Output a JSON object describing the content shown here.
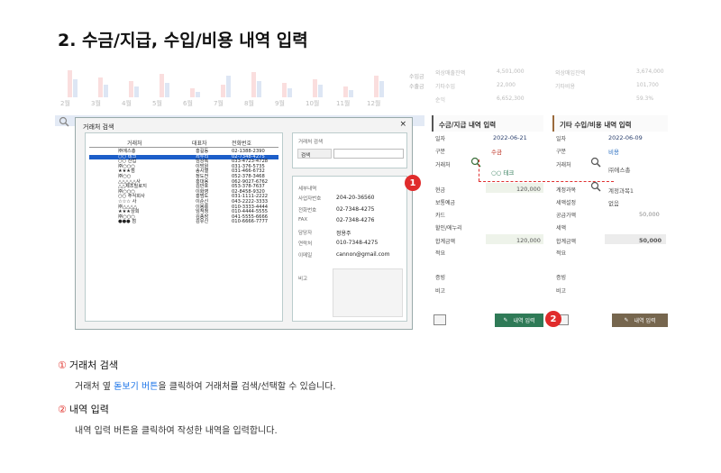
{
  "page_title": "2. 수금/지급, 수입/비용 내역 입력",
  "months": [
    "2월",
    "3월",
    "4월",
    "5월",
    "6월",
    "7월",
    "8월",
    "9월",
    "10월",
    "11월",
    "12월"
  ],
  "legend": [
    "수입금",
    "수출금"
  ],
  "summary": {
    "rows": [
      {
        "label": "외상매출잔액",
        "value": "4,501,000",
        "label2": "외상매입잔액",
        "value2": "3,674,000"
      },
      {
        "label": "기타수입",
        "value": "22,000",
        "label2": "기타비용",
        "value2": "101,700"
      },
      {
        "label": "순익",
        "value": "6,652,300",
        "label2": "",
        "value2": "59.3%"
      }
    ]
  },
  "dialog": {
    "title": "거래처 검색",
    "close": "×",
    "columns": [
      "거래처",
      "대표자",
      "전화번호"
    ],
    "rows": [
      [
        "㈜에스총",
        "홍길동",
        "02-1388-2390"
      ],
      [
        "○○ 테크",
        "최두리",
        "02-7348-4275"
      ],
      [
        "○○ 산업",
        "임상복",
        "033-4723-4728"
      ],
      [
        "㈜○○○",
        "이방원",
        "031-376-5735"
      ],
      [
        "★★★점",
        "송시열",
        "031-466-6732"
      ],
      [
        "㈜○○",
        "정도전",
        "052-378-3468"
      ],
      [
        "△△△△△사",
        "홍대용",
        "062-9027-6762"
      ],
      [
        "△△제조빌로지",
        "김만호",
        "053-378-7637"
      ],
      [
        "㈜○○○",
        "이화영",
        "02-8458-9320"
      ],
      [
        "○○ 주식회사",
        "홍범도",
        "031-1111-2222"
      ],
      [
        "☆☆☆ 사",
        "이순신",
        "043-2222-3333"
      ],
      [
        "㈜△△△△",
        "이봉룡",
        "010-3333-4444"
      ],
      [
        "★★★상회",
        "임적정",
        "010-4444-5555"
      ],
      [
        "㈜○○○",
        "김종장",
        "041-5555-6666"
      ],
      [
        "●●● 점",
        "김유신",
        "010-6666-7777"
      ]
    ],
    "search_panel_title": "거래처 검색",
    "search_label": "검색",
    "detail_panel_title": "세부내역",
    "details": [
      {
        "label": "사업자번호",
        "value": "204-20-36560"
      },
      {
        "label": "전화번호",
        "value": "02-7348-4275"
      },
      {
        "label": "FAX",
        "value": "02-7348-4276"
      },
      {
        "label": "담당자",
        "value": "정용주"
      },
      {
        "label": "연락처",
        "value": "010-7348-4275"
      },
      {
        "label": "이메일",
        "value": "cannon@gmail.com"
      },
      {
        "label": "비고",
        "value": ""
      }
    ]
  },
  "form_left": {
    "title": "수금/지급 내역 입력",
    "date_label": "일자",
    "date": "2022-06-21",
    "type_label": "구분",
    "type": "수금",
    "client_label": "거래처",
    "client": "○○ 테크",
    "cash_label": "현금",
    "cash": "120,000",
    "deposit_label": "보통예금",
    "card_label": "카드",
    "discount_label": "할인/에누리",
    "total_label": "합계금액",
    "total": "120,000",
    "memo_label": "적요",
    "proof_label": "증빙",
    "note_label": "비고",
    "submit": "내역 입력"
  },
  "form_right": {
    "title": "기타 수입/비용 내역 입력",
    "date_label": "일자",
    "date": "2022-06-09",
    "type_label": "구분",
    "type": "비용",
    "client_label": "거래처",
    "client": "㈜에스총",
    "account_label": "계정과목",
    "account": "계정과목1",
    "tax_label": "세액설정",
    "tax": "없음",
    "supply_label": "공급가액",
    "supply": "50,000",
    "vat_label": "세액",
    "total_label": "합계금액",
    "total": "50,000",
    "memo_label": "적요",
    "proof_label": "증빙",
    "note_label": "비고",
    "submit": "내역 입력"
  },
  "markers": [
    "1",
    "2"
  ],
  "sections": [
    {
      "num": "①",
      "title": "거래처 검색",
      "desc_pre": "거래처 옆 ",
      "desc_link": "돋보기 버튼",
      "desc_post": "을 클릭하여 거래처를 검색/선택할 수 있습니다."
    },
    {
      "num": "②",
      "title": "내역 입력",
      "desc_pre": "내역 입력 버튼을 클릭하여 작성한 내역을 입력합니다.",
      "desc_link": "",
      "desc_post": ""
    }
  ]
}
